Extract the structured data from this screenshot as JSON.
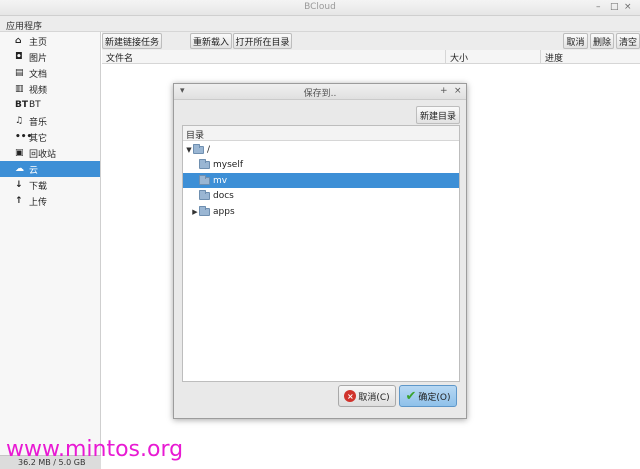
{
  "window": {
    "title": "BCloud",
    "minimize": "–",
    "maximize": "□",
    "close": "×"
  },
  "menubar": {
    "app_menu": "应用程序"
  },
  "sidebar": {
    "items": [
      {
        "icon": "home-icon",
        "glyph": "⌂",
        "label": "主页"
      },
      {
        "icon": "camera-icon",
        "glyph": "◘",
        "label": "图片"
      },
      {
        "icon": "document-icon",
        "glyph": "▤",
        "label": "文档"
      },
      {
        "icon": "film-icon",
        "glyph": "▥",
        "label": "视频"
      },
      {
        "icon": "bt-icon",
        "glyph": "BT",
        "label": "BT"
      },
      {
        "icon": "music-icon",
        "glyph": "♫",
        "label": "音乐"
      },
      {
        "icon": "more-icon",
        "glyph": "•••",
        "label": "其它"
      },
      {
        "icon": "trash-icon",
        "glyph": "▣",
        "label": "回收站"
      },
      {
        "icon": "cloud-icon",
        "glyph": "☁",
        "label": "云"
      },
      {
        "icon": "download-icon",
        "glyph": "↓",
        "label": "下载"
      },
      {
        "icon": "upload-icon",
        "glyph": "↑",
        "label": "上传"
      }
    ],
    "active_index": 8,
    "quota": "36.2 MB / 5.0 GB"
  },
  "toolbar": {
    "new_link_task": "新建链接任务",
    "reload": "重新载入",
    "open_dir": "打开所在目录",
    "cancel": "取消",
    "delete": "删除",
    "clear": "清空"
  },
  "table": {
    "headers": [
      "文件名",
      "大小",
      "进度"
    ]
  },
  "dialog": {
    "title": "保存到..",
    "menu_glyph": "▾",
    "pin_glyph": "+",
    "close_glyph": "×",
    "new_dir": "新建目录",
    "tree_header": "目录",
    "rows": [
      {
        "label": "/",
        "depth": 0,
        "expander": "▼",
        "selected": false
      },
      {
        "label": "myself",
        "depth": 1,
        "expander": "",
        "selected": false
      },
      {
        "label": "mv",
        "depth": 1,
        "expander": "",
        "selected": true
      },
      {
        "label": "docs",
        "depth": 1,
        "expander": "",
        "selected": false
      },
      {
        "label": "apps",
        "depth": 1,
        "expander": "▶",
        "selected": false
      }
    ],
    "cancel_label": "取消(C)",
    "ok_label": "确定(O)",
    "ok_glyph": "✔",
    "cancel_glyph": "×"
  },
  "watermark": "www.mintos.org",
  "colors": {
    "selection": "#3d8fd6",
    "watermark": "#e81ad3"
  }
}
